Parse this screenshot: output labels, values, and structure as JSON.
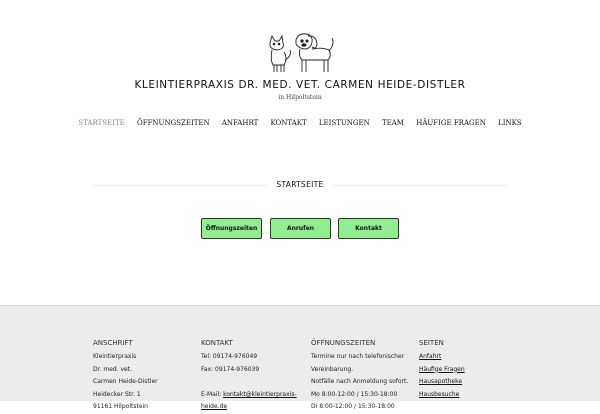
{
  "header": {
    "title": "KLEINTIERPRAXIS DR. MED. VET. CARMEN HEIDE-DISTLER",
    "subtitle": "in Hilpoltstein",
    "logo_icon": "cat-and-dog-drawing-icon"
  },
  "nav": {
    "items": [
      "STARTSEITE",
      "ÖFFNUNGSZEITEN",
      "ANFAHRT",
      "KONTAKT",
      "LEISTUNGEN",
      "TEAM",
      "HÄUFIGE FRAGEN",
      "LINKS"
    ],
    "active": "STARTSEITE"
  },
  "main": {
    "heading": "STARTSEITE",
    "buttons": [
      "Öffnungszeiten",
      "Anrufen",
      "Kontakt"
    ],
    "button_color": "#90ee90"
  },
  "footer": {
    "anschrift": {
      "heading": "ANSCHRIFT",
      "lines": [
        "Kleintierpraxis",
        "Dr. med. vet.",
        "Carmen Heide-Distler",
        "Heidecker Str. 1",
        "91161 Hilpoltstein"
      ]
    },
    "kontakt": {
      "heading": "KONTAKT",
      "tel": "Tel: 09174-976049",
      "fax": "Fax: 09174-976039",
      "email_prefix": "E-Mail: ",
      "email_line1": "kontakt@kleintierpraxis-",
      "email_line2": "heide.de"
    },
    "oeffnungszeiten": {
      "heading": "ÖFFNUNGSZEITEN",
      "lines": [
        "Termine nur nach telefonischer",
        "Vereinbarung.",
        "Notfälle nach Anmeldung sofort.",
        "Mo 8:00-12:00 / 15:30-18:00",
        "Di 8:00-12:00 / 15:30-18:00"
      ]
    },
    "seiten": {
      "heading": "SEITEN",
      "links": [
        "Anfahrt",
        "Häufige Fragen",
        "Hausapotheke",
        "Hausbesuche"
      ]
    }
  }
}
